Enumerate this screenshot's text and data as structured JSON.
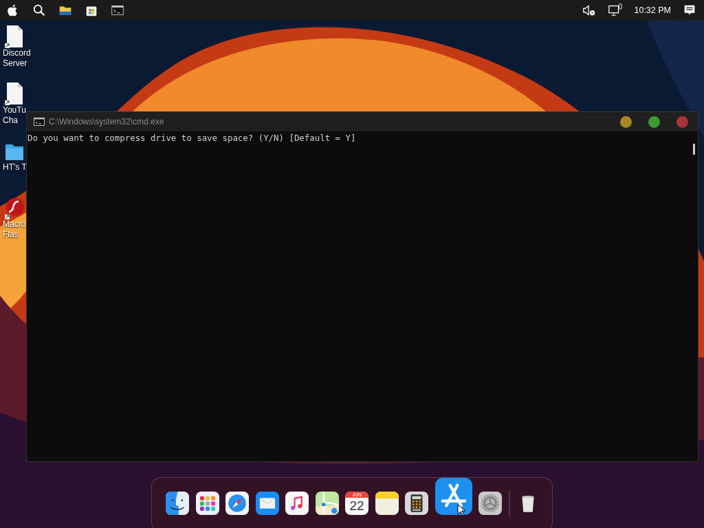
{
  "menu_bar": {
    "left_icons": [
      {
        "kind": "apple"
      },
      {
        "kind": "search"
      },
      {
        "kind": "folder"
      },
      {
        "kind": "store"
      },
      {
        "kind": "terminal"
      }
    ],
    "clock": "10:32 PM"
  },
  "desktop_icons": [
    {
      "kind": "file",
      "lines": [
        "Discord",
        "Server"
      ]
    },
    {
      "kind": "file",
      "lines": [
        "YouTu",
        "Cha"
      ]
    },
    {
      "kind": "folder",
      "lines": [
        "HT's T"
      ]
    },
    {
      "kind": "flash",
      "lines": [
        "Macro",
        "Flas"
      ]
    }
  ],
  "window": {
    "title": "C:\\Windows\\system32\\cmd.exe",
    "lines": [
      "Do you want to compress drive to save space? (Y/N) [Default = Y]"
    ]
  },
  "dock": {
    "items": [
      {
        "kind": "finder",
        "hovered": false
      },
      {
        "kind": "launchpad",
        "hovered": false
      },
      {
        "kind": "safari",
        "hovered": false
      },
      {
        "kind": "mail",
        "hovered": false
      },
      {
        "kind": "music",
        "hovered": false
      },
      {
        "kind": "maps",
        "hovered": false
      },
      {
        "kind": "calendar",
        "hovered": false,
        "month": "JUN",
        "day": "22"
      },
      {
        "kind": "notes",
        "hovered": false
      },
      {
        "kind": "calculator",
        "hovered": false
      },
      {
        "kind": "appstore",
        "hovered": true
      },
      {
        "kind": "settings",
        "hovered": false
      },
      {
        "kind": "separator"
      },
      {
        "kind": "trash",
        "hovered": false
      }
    ]
  }
}
